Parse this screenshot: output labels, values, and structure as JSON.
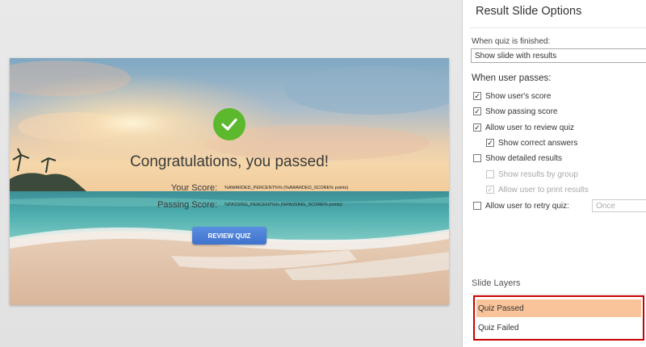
{
  "slide": {
    "title": "Congratulations, you passed!",
    "your_score_label": "Your Score:",
    "your_score_value": "%AWARDED_PERCENT%% (%AWARDED_SCORE% points)",
    "passing_score_label": "Passing Score:",
    "passing_score_value": "%PASSING_PERCENT%% (%PASSING_SCORE% points)",
    "review_button": "REVIEW QUIZ",
    "icon": "check-circle-icon",
    "check_color": "#5cb82c",
    "button_color": "#4a80d6"
  },
  "panel": {
    "title": "Result Slide Options",
    "when_finished_label": "When quiz is finished:",
    "when_finished_value": "Show slide with results",
    "when_passes_heading": "When user passes:",
    "options": [
      {
        "label": "Show user's score",
        "checked": true,
        "enabled": true
      },
      {
        "label": "Show passing score",
        "checked": true,
        "enabled": true
      },
      {
        "label": "Allow user to review quiz",
        "checked": true,
        "enabled": true
      },
      {
        "label": "Show correct answers",
        "checked": true,
        "enabled": true
      },
      {
        "label": "Show detailed results",
        "checked": false,
        "enabled": true
      },
      {
        "label": "Show results by group",
        "checked": false,
        "enabled": false
      },
      {
        "label": "Allow user to print results",
        "checked": true,
        "enabled": false
      },
      {
        "label": "Allow user to retry quiz:",
        "checked": false,
        "enabled": true
      }
    ],
    "retry_value": "Once",
    "layers_heading": "Slide Layers",
    "layers": [
      {
        "label": "Quiz Passed",
        "selected": true
      },
      {
        "label": "Quiz Failed",
        "selected": false
      }
    ],
    "highlight_color": "#cc0000",
    "selected_color": "#fac49a"
  }
}
